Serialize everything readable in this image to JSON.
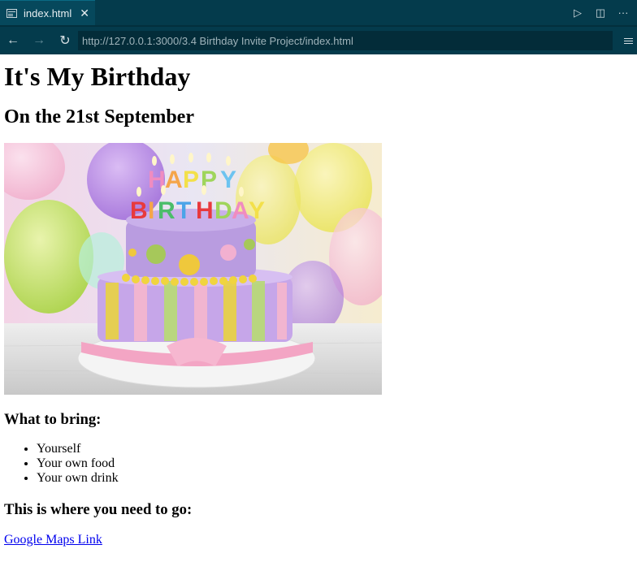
{
  "tab": {
    "title": "index.html",
    "close": "✕"
  },
  "toolbar": {
    "run": "▷",
    "split": "◫",
    "more": "···"
  },
  "nav": {
    "back": "←",
    "forward": "→",
    "reload": "↻",
    "url": "http://127.0.0.1:3000/3.4 Birthday Invite Project/index.html"
  },
  "page": {
    "title": "It's My Birthday",
    "date": "On the 21st September",
    "image_alt": "birthday cake",
    "bring_heading": "What to bring:",
    "bring_items": [
      "Yourself",
      "Your own food",
      "Your own drink"
    ],
    "where_heading": "This is where you need to go:",
    "map_link": "Google Maps Link"
  },
  "colors": {
    "chrome": "#043b4c",
    "tab_active": "#06485c",
    "link": "#0000ee"
  }
}
